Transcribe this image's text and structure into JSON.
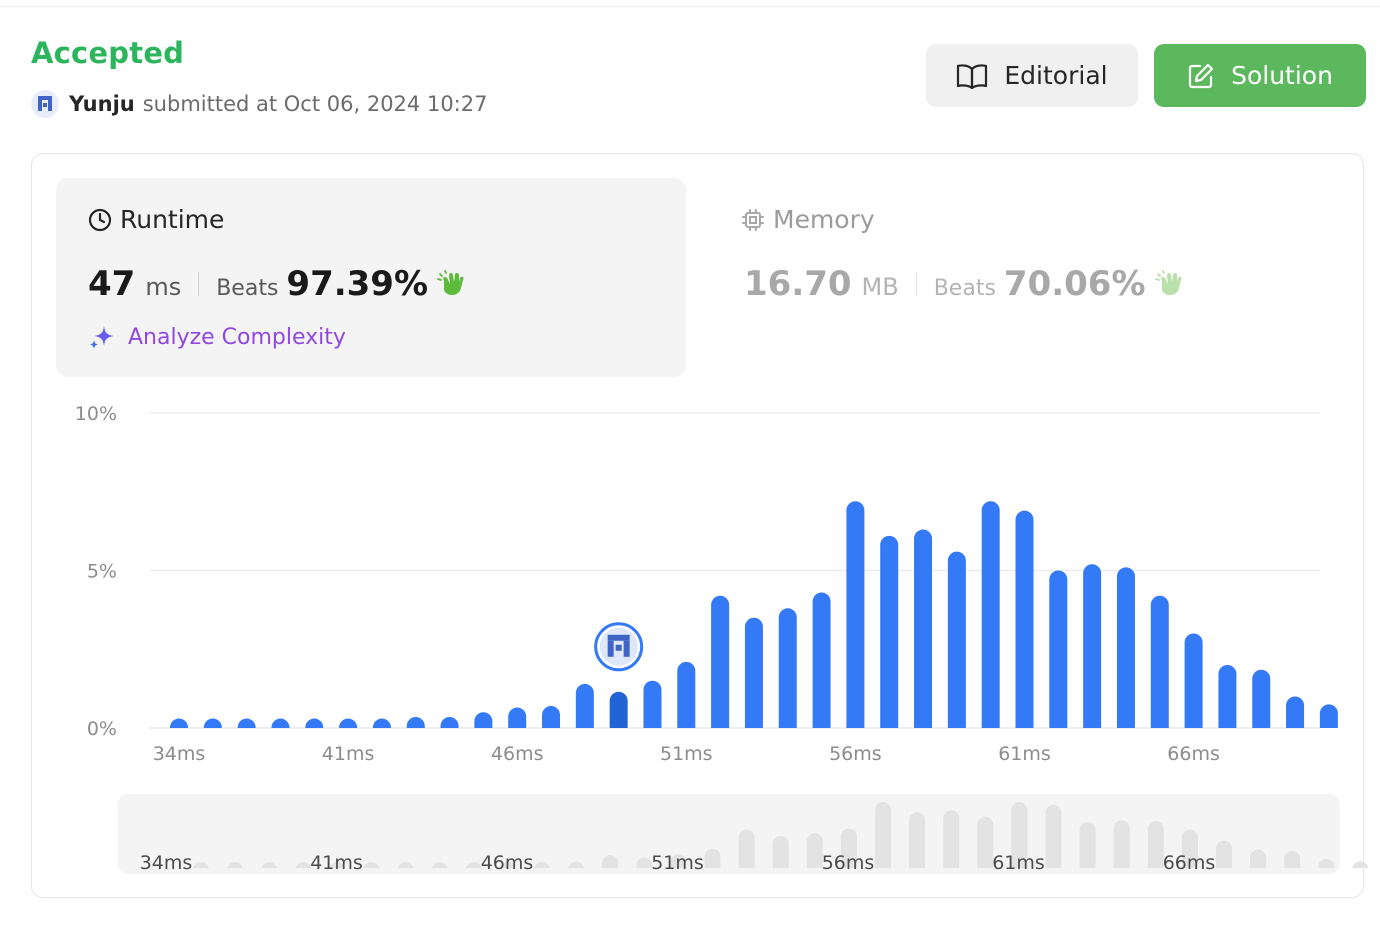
{
  "header": {
    "status": "Accepted",
    "username": "Yunju",
    "submitted_text": "submitted at Oct 06, 2024 10:27",
    "editorial_label": "Editorial",
    "solution_label": "Solution"
  },
  "runtime": {
    "title": "Runtime",
    "value": "47",
    "unit": "ms",
    "beats_label": "Beats",
    "beats": "97.39%",
    "analyze_label": "Analyze Complexity"
  },
  "memory": {
    "title": "Memory",
    "value": "16.70",
    "unit": "MB",
    "beats_label": "Beats",
    "beats": "70.06%"
  },
  "colors": {
    "accepted": "#2db55d",
    "bar": "#3479f6",
    "bar_highlight": "#2263d6",
    "solution_button": "#5cb85c",
    "analyze": "#9048e0",
    "mini_bar": "#e3e3e3"
  },
  "icons": [
    "user-avatar-icon",
    "book-open-icon",
    "edit-icon",
    "clock-icon",
    "cpu-icon",
    "clap-icon",
    "sparkle-icon"
  ],
  "chart_data": {
    "type": "bar",
    "x": [
      34,
      35,
      36,
      37,
      38,
      39,
      40,
      41,
      42,
      43,
      44,
      45,
      46,
      47,
      48,
      49,
      50,
      51,
      52,
      53,
      54,
      55,
      56,
      57,
      58,
      59,
      60,
      61,
      62,
      63,
      64,
      65,
      66,
      67,
      68
    ],
    "values": [
      0.3,
      0.3,
      0.3,
      0.3,
      0.3,
      0.3,
      0.3,
      0.35,
      0.35,
      0.5,
      0.65,
      0.7,
      1.4,
      1.15,
      1.5,
      2.1,
      4.2,
      3.5,
      3.8,
      4.3,
      7.2,
      6.1,
      6.3,
      5.6,
      7.2,
      6.9,
      5.0,
      5.2,
      5.1,
      4.2,
      3.0,
      2.0,
      1.85,
      1.0,
      0.75
    ],
    "highlight_index": 13,
    "highlight_x": 47,
    "y_ticks": [
      "0%",
      "5%",
      "10%"
    ],
    "ylim": [
      0,
      10
    ],
    "x_tick_labels": [
      "34ms",
      "41ms",
      "46ms",
      "51ms",
      "56ms",
      "61ms",
      "66ms"
    ],
    "x_tick_at": [
      34,
      39,
      44,
      49,
      54,
      59,
      64
    ],
    "grid": true
  }
}
